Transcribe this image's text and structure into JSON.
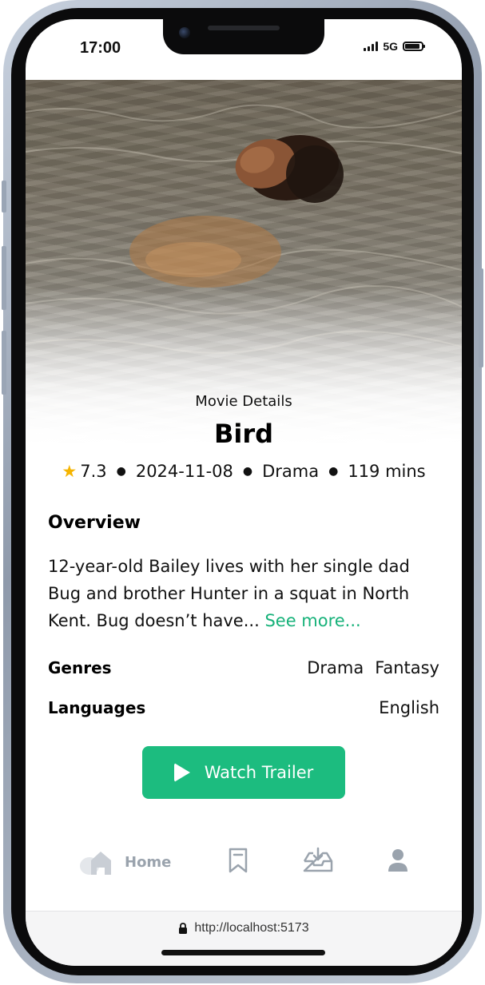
{
  "status_bar": {
    "time": "17:00",
    "network": "5G"
  },
  "movie": {
    "section_label": "Movie Details",
    "title": "Bird",
    "rating": "7.3",
    "release_date": "2024-11-08",
    "genre": "Drama",
    "runtime": "119 mins"
  },
  "overview": {
    "heading": "Overview",
    "text": "12-year-old Bailey lives with her single dad Bug and brother Hunter in a squat in North Kent. Bug doesn’t have...",
    "see_more": "See more..."
  },
  "details": {
    "genres_label": "Genres",
    "genres": [
      "Drama",
      "Fantasy"
    ],
    "languages_label": "Languages",
    "languages": [
      "English"
    ]
  },
  "actions": {
    "watch_trailer": "Watch Trailer"
  },
  "nav": {
    "items": [
      {
        "label": "Home",
        "icon": "home-icon",
        "active": true
      },
      {
        "label": "",
        "icon": "bookmark-icon",
        "active": false
      },
      {
        "label": "",
        "icon": "download-icon",
        "active": false
      },
      {
        "label": "",
        "icon": "profile-icon",
        "active": false
      }
    ]
  },
  "browser": {
    "url": "http://localhost:5173"
  },
  "colors": {
    "accent": "#1cbc7f",
    "nav_inactive": "#9aa3ad",
    "star": "#f5b400"
  }
}
